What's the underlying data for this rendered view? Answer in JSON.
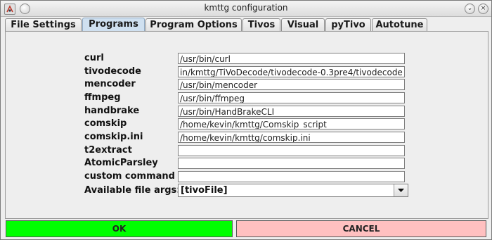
{
  "window": {
    "title": "kmttg configuration",
    "icons": [
      "app-icon",
      "pin-icon",
      "minimize-icon",
      "close-icon"
    ]
  },
  "tabs": [
    {
      "label": "File Settings",
      "active": false
    },
    {
      "label": "Programs",
      "active": true
    },
    {
      "label": "Program Options",
      "active": false
    },
    {
      "label": "Tivos",
      "active": false
    },
    {
      "label": "Visual",
      "active": false
    },
    {
      "label": "pyTivo",
      "active": false
    },
    {
      "label": "Autotune",
      "active": false
    }
  ],
  "programs": {
    "curl": {
      "label": "curl",
      "value": "/usr/bin/curl"
    },
    "tivodecode": {
      "label": "tivodecode",
      "value": "in/kmttg/TiVoDecode/tivodecode-0.3pre4/tivodecode"
    },
    "mencoder": {
      "label": "mencoder",
      "value": "/usr/bin/mencoder"
    },
    "ffmpeg": {
      "label": "ffmpeg",
      "value": "/usr/bin/ffmpeg"
    },
    "handbrake": {
      "label": "handbrake",
      "value": "/usr/bin/HandBrakeCLI"
    },
    "comskip": {
      "label": "comskip",
      "value": "/home/kevin/kmttg/Comskip_script"
    },
    "comskip_ini": {
      "label": "comskip.ini",
      "value": "/home/kevin/kmttg/comskip.ini"
    },
    "t2extract": {
      "label": "t2extract",
      "value": ""
    },
    "atomicparsley": {
      "label": "AtomicParsley",
      "value": ""
    },
    "custom": {
      "label": "custom command",
      "value": ""
    }
  },
  "file_args": {
    "label": "Available file args:",
    "selected": "[tivoFile]"
  },
  "buttons": {
    "ok": "OK",
    "cancel": "CANCEL"
  },
  "colors": {
    "ok_bg": "#00ff00",
    "cancel_bg": "#ffc0c0",
    "active_tab_bg": "#cfe0f0"
  }
}
